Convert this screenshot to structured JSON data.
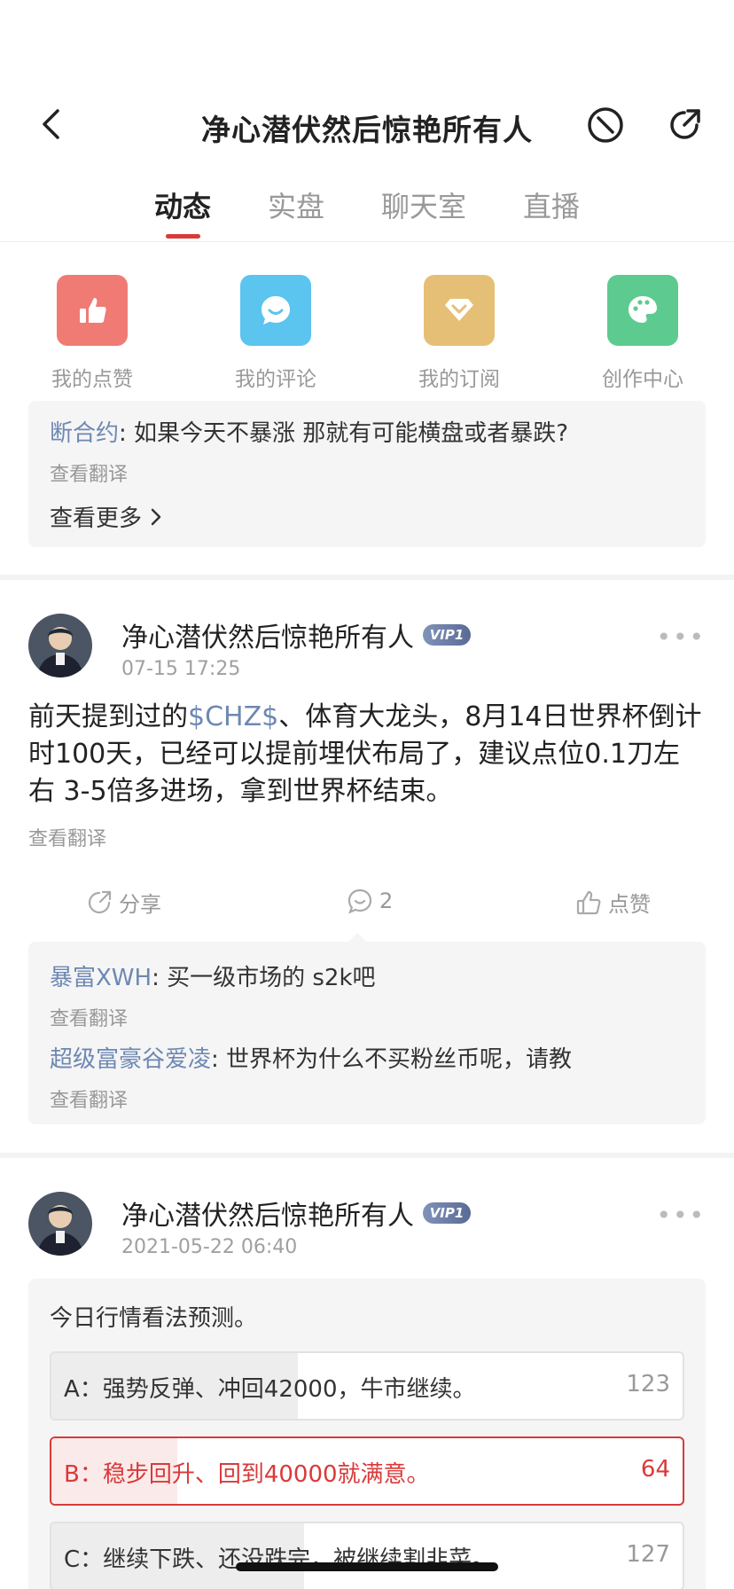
{
  "header": {
    "title": "净心潜伏然后惊艳所有人"
  },
  "tabs": [
    {
      "label": "动态"
    },
    {
      "label": "实盘"
    },
    {
      "label": "聊天室"
    },
    {
      "label": "直播"
    }
  ],
  "quick_actions": [
    {
      "label": "我的点赞",
      "color": "#ef7b74",
      "icon": "thumbs-up-icon"
    },
    {
      "label": "我的评论",
      "color": "#5bc4ef",
      "icon": "comment-icon"
    },
    {
      "label": "我的订阅",
      "color": "#e6bf77",
      "icon": "subscribe-icon"
    },
    {
      "label": "创作中心",
      "color": "#5dcb8f",
      "icon": "palette-icon"
    }
  ],
  "top_comments": {
    "items": [
      {
        "user": "断合约",
        "text": ": 如果今天不暴涨 那就有可能横盘或者暴跌?",
        "translate": "查看翻译"
      }
    ],
    "more": "查看更多"
  },
  "posts": [
    {
      "author": "净心潜伏然后惊艳所有人",
      "vip": "VIP1",
      "time": "07-15 17:25",
      "body_pre": "前天提到过的",
      "body_link": "$CHZ$",
      "body_post": "、体育大龙头，8月14日世界杯倒计时100天，已经可以提前埋伏布局了，建议点位0.1刀左右 3-5倍多进场，拿到世界杯结束。",
      "translate": "查看翻译",
      "share": "分享",
      "comments": "2",
      "like": "点赞",
      "comment_list": [
        {
          "user": "暴富XWH",
          "text": ": 买一级市场的 s2k吧",
          "translate": "查看翻译"
        },
        {
          "user": "超级富豪谷爱凌",
          "text": ": 世界杯为什么不买粉丝币呢，请教",
          "translate": "查看翻译"
        }
      ]
    },
    {
      "author": "净心潜伏然后惊艳所有人",
      "vip": "VIP1",
      "time": "2021-05-22 06:40",
      "poll": {
        "question": "今日行情看法预测。",
        "options": [
          {
            "text": "A：强势反弹、冲回42000，牛市继续。",
            "count": "123",
            "fill": 0.39
          },
          {
            "text": "B：稳步回升、回到40000就满意。",
            "count": "64",
            "fill": 0.2,
            "selected": true
          },
          {
            "text": "C：继续下跌、还没跌完，被继续割韭菜。",
            "count": "127",
            "fill": 0.4
          }
        ]
      }
    }
  ]
}
